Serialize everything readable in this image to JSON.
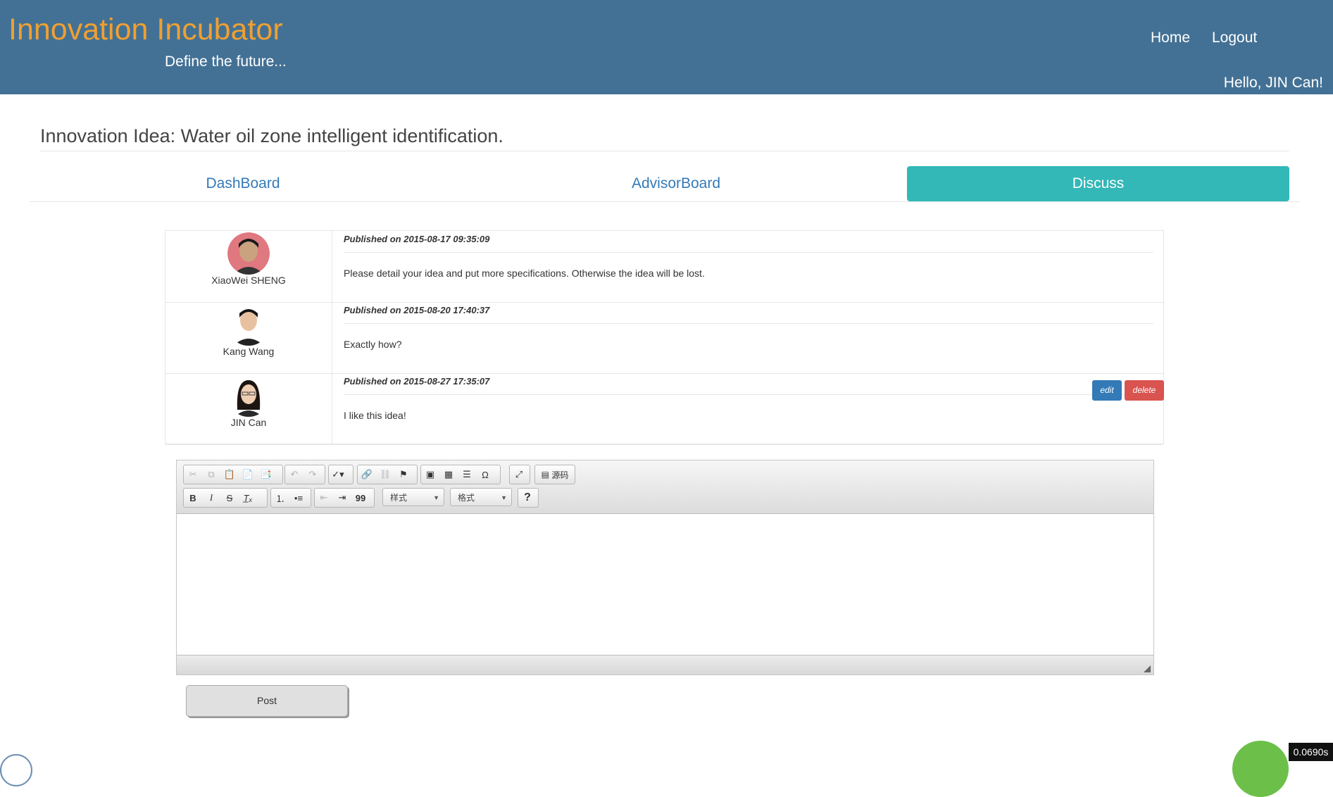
{
  "header": {
    "brand": "Innovation Incubator",
    "tagline": "Define the future...",
    "nav": [
      "Home",
      "Logout"
    ],
    "greeting": "Hello, JIN Can!"
  },
  "idea": {
    "title": "Innovation Idea: Water oil zone intelligent identification."
  },
  "tabs": [
    {
      "label": "DashBoard",
      "active": false
    },
    {
      "label": "AdvisorBoard",
      "active": false
    },
    {
      "label": "Discuss",
      "active": true
    }
  ],
  "comments": [
    {
      "author": "XiaoWei SHENG",
      "published": "Published on 2015-08-17 09:35:09",
      "text": "Please detail your idea and put more specifications. Otherwise the idea will be lost."
    },
    {
      "author": "Kang Wang",
      "published": "Published on 2015-08-20 17:40:37",
      "text": "Exactly how?"
    },
    {
      "author": "JIN Can",
      "published": "Published on 2015-08-27 17:35:07",
      "text": "I like this idea!",
      "actions": [
        "edit",
        "delete"
      ]
    }
  ],
  "editor": {
    "toolbar_icons": [
      "cut-icon",
      "copy-icon",
      "paste-icon",
      "paste-text-icon",
      "paste-word-icon",
      "undo-icon",
      "redo-icon",
      "spellcheck-icon",
      "link-icon",
      "unlink-icon",
      "anchor-icon",
      "image-icon",
      "table-icon",
      "horizontal-line-icon",
      "special-char-icon",
      "maximize-icon",
      "source-icon",
      "bold-icon",
      "italic-icon",
      "strike-icon",
      "remove-format-icon",
      "numbered-list-icon",
      "bulleted-list-icon",
      "outdent-icon",
      "indent-icon",
      "blockquote-icon",
      "help-icon"
    ],
    "source_label": "源码",
    "styles_label": "样式",
    "format_label": "格式",
    "help_label": "?",
    "omega": "Ω",
    "quote": "99"
  },
  "post_label": "Post",
  "timer": "0.0690s",
  "colors": {
    "header": "#437195",
    "brand": "#f0a030",
    "active_tab": "#33b7b7",
    "edit": "#337ab7",
    "delete": "#d9534f"
  }
}
